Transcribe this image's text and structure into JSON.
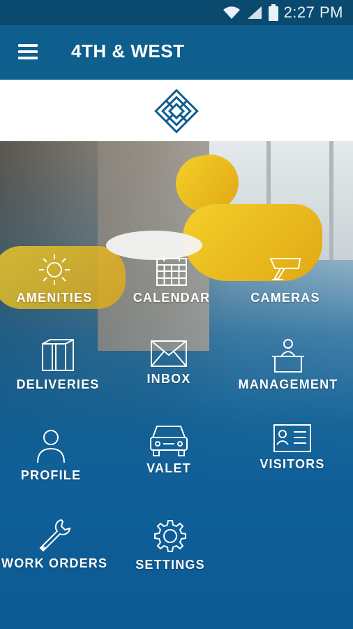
{
  "status_bar": {
    "time": "2:27 PM",
    "icons": [
      "wifi-icon",
      "signal-icon",
      "battery-icon"
    ]
  },
  "app_bar": {
    "title": "4TH & WEST",
    "menu_icon": "hamburger-menu-icon"
  },
  "colors": {
    "app_bar": "#0e5f8e",
    "status_bar": "#0b4a6f",
    "logo": "#0e5f8e",
    "tile_text": "#ffffff"
  },
  "tiles": [
    {
      "label": "AMENITIES",
      "icon": "sun-icon"
    },
    {
      "label": "CALENDAR",
      "icon": "calendar-icon"
    },
    {
      "label": "CAMERAS",
      "icon": "security-camera-icon"
    },
    {
      "label": "DELIVERIES",
      "icon": "package-icon"
    },
    {
      "label": "INBOX",
      "icon": "envelope-icon"
    },
    {
      "label": "MANAGEMENT",
      "icon": "front-desk-icon"
    },
    {
      "label": "PROFILE",
      "icon": "person-icon"
    },
    {
      "label": "VALET",
      "icon": "car-icon"
    },
    {
      "label": "VISITORS",
      "icon": "id-card-icon"
    },
    {
      "label": "WORK ORDERS",
      "icon": "wrench-icon"
    },
    {
      "label": "SETTINGS",
      "icon": "gear-icon"
    }
  ]
}
